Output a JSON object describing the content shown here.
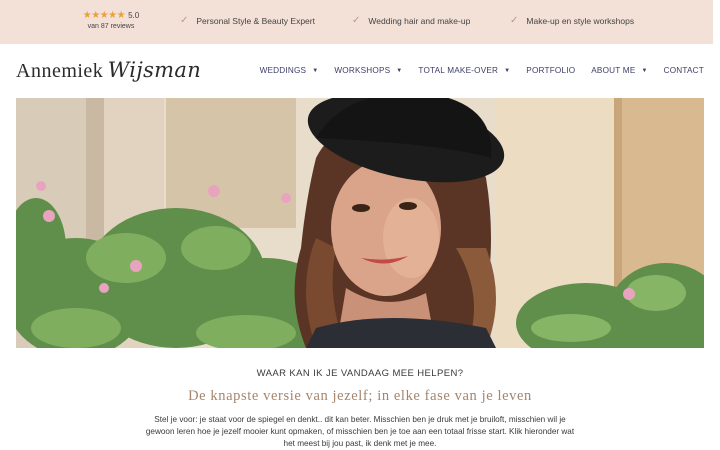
{
  "topbar": {
    "rating": {
      "stars": "★★★★★",
      "score": "5.0",
      "reviews": "van 87 reviews",
      "star_color": "#e9a23b"
    },
    "usps": [
      {
        "icon": "check-icon",
        "label": "Personal Style & Beauty Expert"
      },
      {
        "icon": "check-icon",
        "label": "Wedding hair and make-up"
      },
      {
        "icon": "check-icon",
        "label": "Make-up en style workshops"
      }
    ],
    "background": "#f3e0d6"
  },
  "header": {
    "logo_first": "Annemiek",
    "logo_last": "Wijsman",
    "nav": [
      {
        "label": "WEDDINGS",
        "dropdown": true
      },
      {
        "label": "WORKSHOPS",
        "dropdown": true
      },
      {
        "label": "TOTAL MAKE-OVER",
        "dropdown": true
      },
      {
        "label": "PORTFOLIO",
        "dropdown": false
      },
      {
        "label": "ABOUT ME",
        "dropdown": true
      },
      {
        "label": "CONTACT",
        "dropdown": false
      }
    ],
    "nav_color": "#3d3d6a"
  },
  "intro": {
    "eyebrow": "WAAR KAN IK JE VANDAAG MEE HELPEN?",
    "headline": "De knapste versie van jezelf; in elke fase van je leven",
    "body": "Stel je voor: je staat voor de spiegel en denkt.. dit kan beter. Misschien ben je druk met je bruiloft, misschien wil je gewoon leren hoe je jezelf mooier kunt opmaken, of misschien ben je toe aan een totaal frisse start. Klik hieronder wat het meest bij jou past, ik denk met je mee.",
    "headline_color": "#a5856c"
  }
}
